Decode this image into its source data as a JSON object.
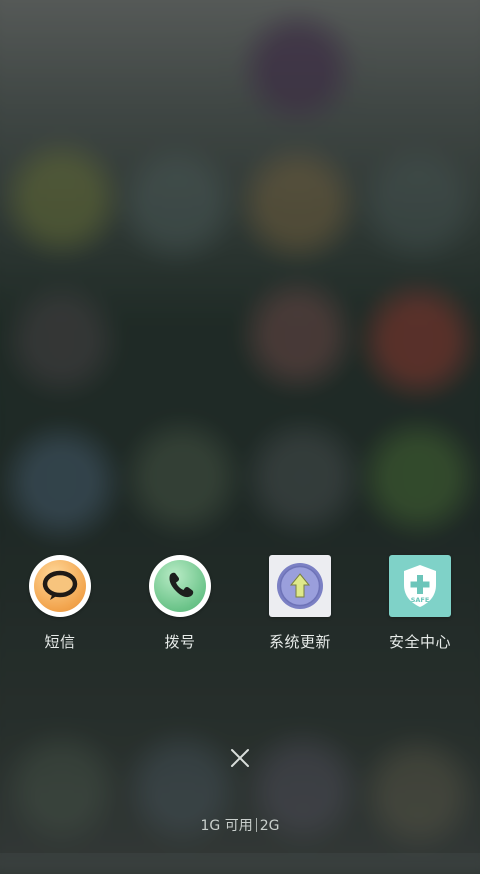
{
  "apps": [
    {
      "label": "短信",
      "icon": "message-bubble-icon",
      "accent": "#f5a34c"
    },
    {
      "label": "拨号",
      "icon": "phone-icon",
      "accent": "#6cc48a"
    },
    {
      "label": "系统更新",
      "icon": "upload-arrow-icon",
      "accent": "#8a8fd0"
    },
    {
      "label": "安全中心",
      "icon": "shield-safe-icon",
      "accent": "#7fd2c8"
    }
  ],
  "close": {
    "icon": "close-icon",
    "glyph": "×"
  },
  "memory": {
    "available": "1G 可用",
    "total": "2G"
  }
}
